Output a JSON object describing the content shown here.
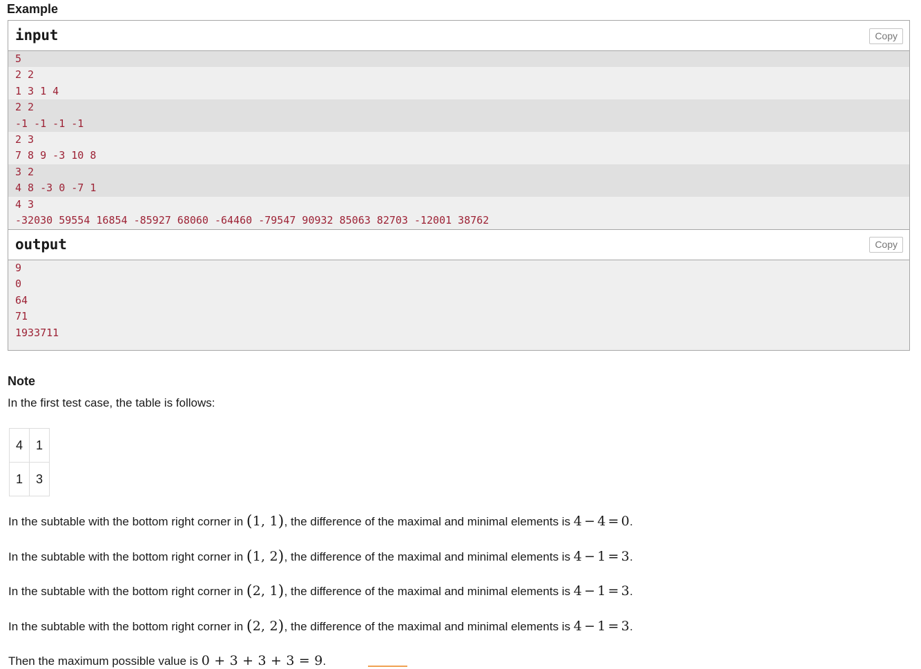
{
  "headings": {
    "example": "Example",
    "note": "Note"
  },
  "sample_tests": {
    "input": {
      "title": "input",
      "copy_label": "Copy",
      "lines": [
        "5",
        "2 2",
        "1 3 1 4",
        "2 2",
        "-1 -1 -1 -1",
        "2 3",
        "7 8 9 -3 10 8",
        "3 2",
        "4 8 -3 0 -7 1",
        "4 3",
        "-32030 59554 16854 -85927 68060 -64460 -79547 90932 85063 82703 -12001 38762"
      ]
    },
    "output": {
      "title": "output",
      "copy_label": "Copy",
      "lines": [
        "9",
        "0",
        "64",
        "71",
        "1933711"
      ]
    }
  },
  "note": {
    "intro": "In the first test case, the table is follows:",
    "table": [
      [
        "4",
        "1"
      ],
      [
        "1",
        "3"
      ]
    ],
    "paragraphs": [
      {
        "lead": "In the subtable with the bottom right corner in ",
        "coord_open": "(",
        "coord": "1, 1",
        "coord_close": ")",
        "mid": ", the difference of the maximal and minimal elements is ",
        "expr_a": "4",
        "expr_minus": "−",
        "expr_b": "4",
        "expr_eq": "=",
        "expr_result": "0",
        "tail": "."
      },
      {
        "lead": "In the subtable with the bottom right corner in ",
        "coord_open": "(",
        "coord": "1, 2",
        "coord_close": ")",
        "mid": ", the difference of the maximal and minimal elements is ",
        "expr_a": "4",
        "expr_minus": "−",
        "expr_b": "1",
        "expr_eq": "=",
        "expr_result": "3",
        "tail": "."
      },
      {
        "lead": "In the subtable with the bottom right corner in ",
        "coord_open": "(",
        "coord": "2, 1",
        "coord_close": ")",
        "mid": ", the difference of the maximal and minimal elements is ",
        "expr_a": "4",
        "expr_minus": "−",
        "expr_b": "1",
        "expr_eq": "=",
        "expr_result": "3",
        "tail": "."
      },
      {
        "lead": "In the subtable with the bottom right corner in ",
        "coord_open": "(",
        "coord": "2, 2",
        "coord_close": ")",
        "mid": ", the difference of the maximal and minimal elements is ",
        "expr_a": "4",
        "expr_minus": "−",
        "expr_b": "1",
        "expr_eq": "=",
        "expr_result": "3",
        "tail": "."
      }
    ],
    "conclusion": {
      "lead": "Then the maximum possible value is ",
      "expr": "0 + 3 + 3 + 3 = 9",
      "tail": "."
    }
  },
  "colors": {
    "code_text": "#9d2235",
    "band": "#e0e0e0",
    "pre_background": "#efefef",
    "container_border": "#a6a6a6",
    "copy_border": "#c4c4c4",
    "copy_text": "#767676",
    "table_border": "#dcdcdc",
    "focus_underline": "#f0a050"
  }
}
